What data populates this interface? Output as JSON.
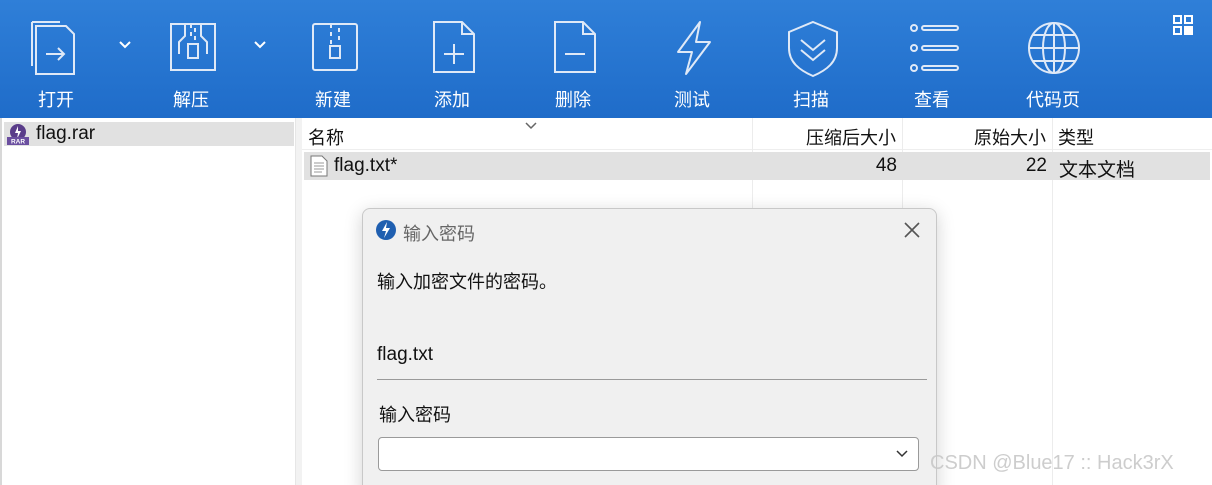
{
  "toolbar": {
    "buttons": [
      {
        "label": "打开",
        "icon": "open-icon"
      },
      {
        "label": "解压",
        "icon": "extract-icon"
      },
      {
        "label": "新建",
        "icon": "new-archive-icon"
      },
      {
        "label": "添加",
        "icon": "add-file-icon"
      },
      {
        "label": "删除",
        "icon": "delete-file-icon"
      },
      {
        "label": "测试",
        "icon": "test-icon"
      },
      {
        "label": "扫描",
        "icon": "scan-shield-icon"
      },
      {
        "label": "查看",
        "icon": "view-list-icon"
      },
      {
        "label": "代码页",
        "icon": "codepage-globe-icon"
      }
    ],
    "background_color": "#2173d0"
  },
  "tree": {
    "items": [
      {
        "label": "flag.rar",
        "icon": "rar-archive-icon"
      }
    ]
  },
  "list": {
    "columns": [
      "名称",
      "压缩后大小",
      "原始大小",
      "类型"
    ],
    "rows": [
      {
        "name": "flag.txt*",
        "packed": "48",
        "size": "22",
        "type": "文本文档",
        "icon": "text-file-icon"
      }
    ]
  },
  "dialog": {
    "title": "输入密码",
    "message": "输入加密文件的密码。",
    "file_name": "flag.txt",
    "password_label": "输入密码",
    "password_value": ""
  },
  "watermark": "CSDN @Blue17 :: Hack3rX"
}
